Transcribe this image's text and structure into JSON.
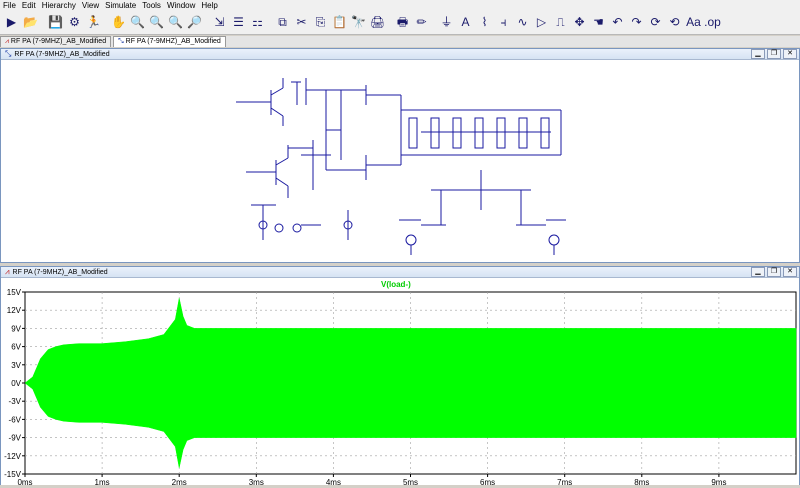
{
  "menu": [
    "File",
    "Edit",
    "Hierarchy",
    "View",
    "Simulate",
    "Tools",
    "Window",
    "Help"
  ],
  "toolbar_icons": [
    "run-icon",
    "open-icon",
    "save-icon",
    "control-panel-icon",
    "halt-icon",
    "pan-icon",
    "zoom-in-icon",
    "zoom-out-icon",
    "zoom-fit-icon",
    "zoom-cancel-icon",
    "autorange-icon",
    "tile-horizontal-icon",
    "tile-vertical-icon",
    "cascade-icon",
    "cut-icon",
    "copy-icon",
    "paste-icon",
    "find-icon",
    "print-icon",
    "print-setup-icon",
    "wire-icon",
    "ground-icon",
    "label-icon",
    "resistor-icon",
    "capacitor-icon",
    "inductor-icon",
    "diode-icon",
    "component-icon",
    "move-icon",
    "drag-icon",
    "undo-icon",
    "redo-icon",
    "rotate-icon",
    "mirror-icon",
    "text-icon",
    "spice-directive-icon"
  ],
  "toolbar_glyphs": [
    "▶",
    "📂",
    "💾",
    "⚙",
    "🏃",
    "✋",
    "🔍",
    "🔍",
    "🔍",
    "🔎",
    "⇲",
    "☰",
    "⚏",
    "⧉",
    "✂",
    "⎘",
    "📋",
    "🔭",
    "🖨",
    "🖶",
    "✏",
    "⏚",
    "A",
    "⌇",
    "⫞",
    "∿",
    "▷",
    "⎍",
    "✥",
    "☚",
    "↶",
    "↷",
    "⟳",
    "⟲",
    "Aa",
    ".op"
  ],
  "tabs": [
    {
      "label": "RF PA (7-9MHZ)_AB_Modified",
      "icon": "waveform-icon"
    },
    {
      "label": "RF PA (7-9MHZ)_AB_Modified",
      "icon": "schematic-icon"
    }
  ],
  "schematic_window": {
    "title": "RF PA (7-9MHZ)_AB_Modified"
  },
  "plot_window": {
    "title": "RF PA (7-9MHZ)_AB_Modified",
    "trace_name": "V(load-)"
  },
  "colors": {
    "trace": "#00ff00",
    "trace_label": "#00cc00",
    "grid": "#a0a0a0"
  },
  "chart_data": {
    "type": "area",
    "title": "",
    "series": [
      {
        "name": "V(load-)",
        "color": "#00ff00"
      }
    ],
    "y_ticks": [
      "15V",
      "12V",
      "9V",
      "6V",
      "3V",
      "0V",
      "-3V",
      "-6V",
      "-9V",
      "-12V",
      "-15V"
    ],
    "x_ticks": [
      "0ms",
      "1ms",
      "2ms",
      "3ms",
      "4ms",
      "5ms",
      "6ms",
      "7ms",
      "8ms",
      "9ms"
    ],
    "ylim": [
      -15,
      15
    ],
    "xlim": [
      0,
      10
    ],
    "x_unit": "ms",
    "envelope": {
      "x": [
        0,
        0.1,
        0.15,
        0.2,
        0.3,
        0.4,
        0.5,
        0.7,
        1.0,
        1.3,
        1.6,
        1.8,
        1.95,
        2.0,
        2.05,
        2.1,
        2.2,
        2.4,
        10
      ],
      "upper": [
        0,
        1,
        2.5,
        4,
        5.5,
        6.0,
        6.3,
        6.5,
        6.5,
        6.8,
        7.3,
        8.0,
        10.5,
        14.0,
        11.0,
        9.5,
        9.0,
        9.0,
        9.0
      ],
      "lower": [
        0,
        -1,
        -2.5,
        -4,
        -5.5,
        -6.0,
        -6.3,
        -6.5,
        -6.5,
        -6.8,
        -7.3,
        -8.0,
        -10.5,
        -14.0,
        -11.0,
        -9.5,
        -9.0,
        -9.0,
        -9.0
      ]
    },
    "grid": true,
    "grid_style": "dashed"
  }
}
